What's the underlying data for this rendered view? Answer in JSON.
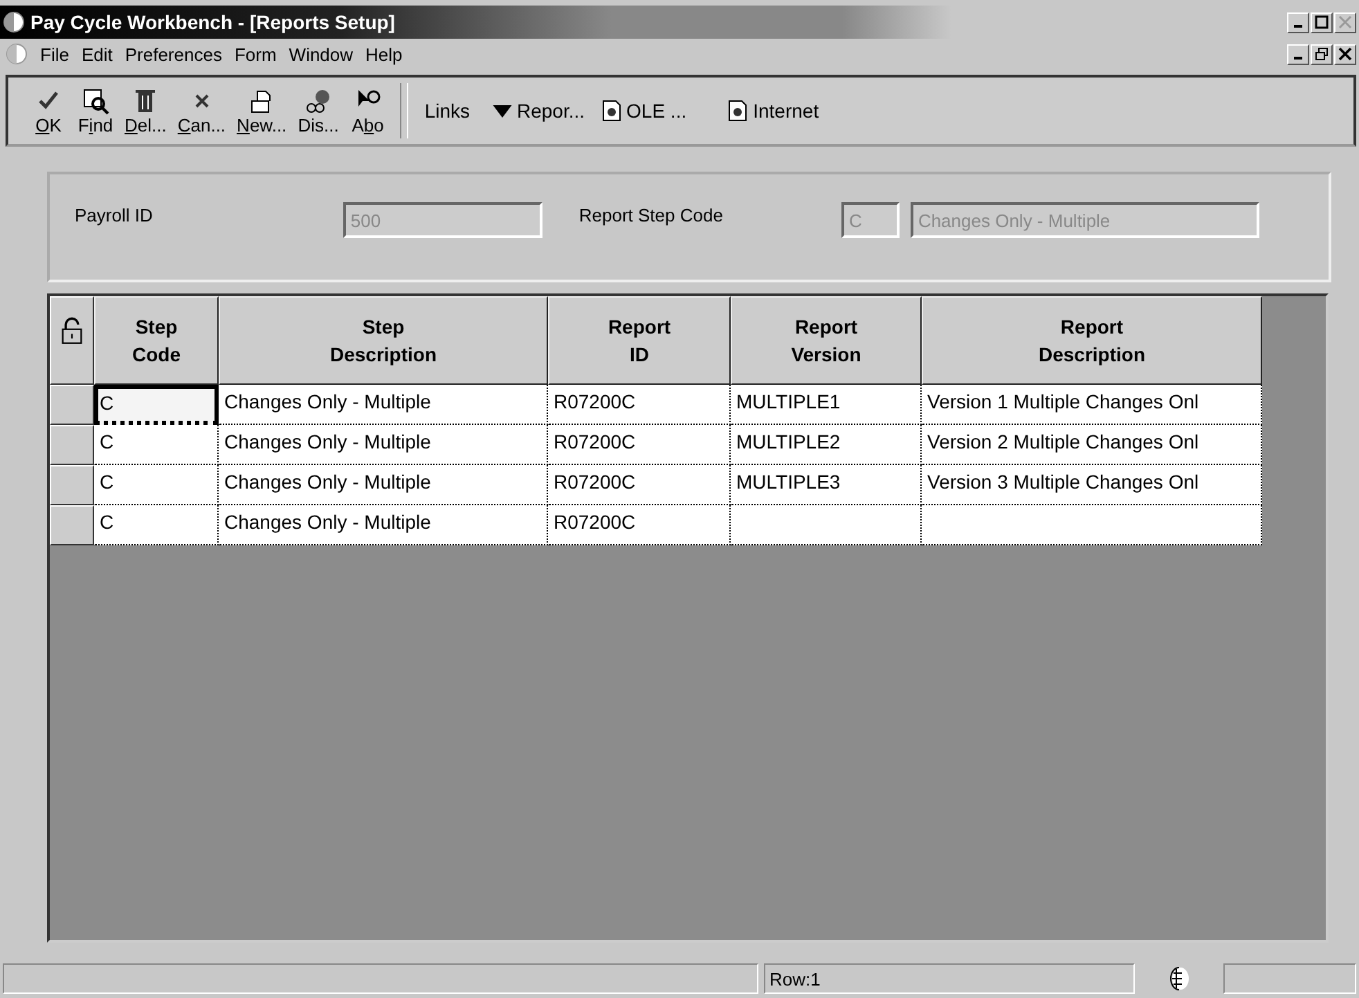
{
  "window": {
    "title": "Pay Cycle Workbench - [Reports Setup]"
  },
  "menu": [
    "File",
    "Edit",
    "Preferences",
    "Form",
    "Window",
    "Help"
  ],
  "toolbar": [
    {
      "key": "O",
      "post": "K"
    },
    {
      "pre": "F",
      "key": "i",
      "post": "nd"
    },
    {
      "key": "D",
      "post": "el..."
    },
    {
      "key": "C",
      "post": "an..."
    },
    {
      "key": "N",
      "post": "ew..."
    },
    {
      "pre": "Dis..."
    },
    {
      "pre": "A",
      "key": "b",
      "post": "o"
    }
  ],
  "links": [
    {
      "kind": "menu",
      "label": "Links"
    },
    {
      "kind": "menu",
      "label": "Repor..."
    },
    {
      "kind": "doc",
      "label": "OLE ..."
    },
    {
      "kind": "doc",
      "label": "Internet"
    }
  ],
  "form": {
    "payroll_id": {
      "label": "Payroll ID",
      "value": "500"
    },
    "report_step_code": {
      "label": "Report Step Code",
      "value": "C",
      "description": "Changes Only - Multiple"
    }
  },
  "table": {
    "columns": [
      "Step Code",
      "Step Description",
      "Report ID",
      "Report Version",
      "Report Description"
    ],
    "rows": [
      {
        "focused": true,
        "cells": [
          "C",
          "Changes Only - Multiple",
          "R07200C",
          "MULTIPLE1",
          "Version 1 Multiple Changes Onl"
        ]
      },
      {
        "focused": false,
        "cells": [
          "C",
          "Changes Only - Multiple",
          "R07200C",
          "MULTIPLE2",
          "Version 2 Multiple Changes Onl"
        ]
      },
      {
        "focused": false,
        "cells": [
          "C",
          "Changes Only - Multiple",
          "R07200C",
          "MULTIPLE3",
          "Version 3 Multiple Changes Onl"
        ]
      },
      {
        "focused": false,
        "cells": [
          "C",
          "Changes Only - Multiple",
          "R07200C",
          "",
          ""
        ]
      }
    ]
  },
  "status_bar": {
    "row": "Row:1"
  }
}
